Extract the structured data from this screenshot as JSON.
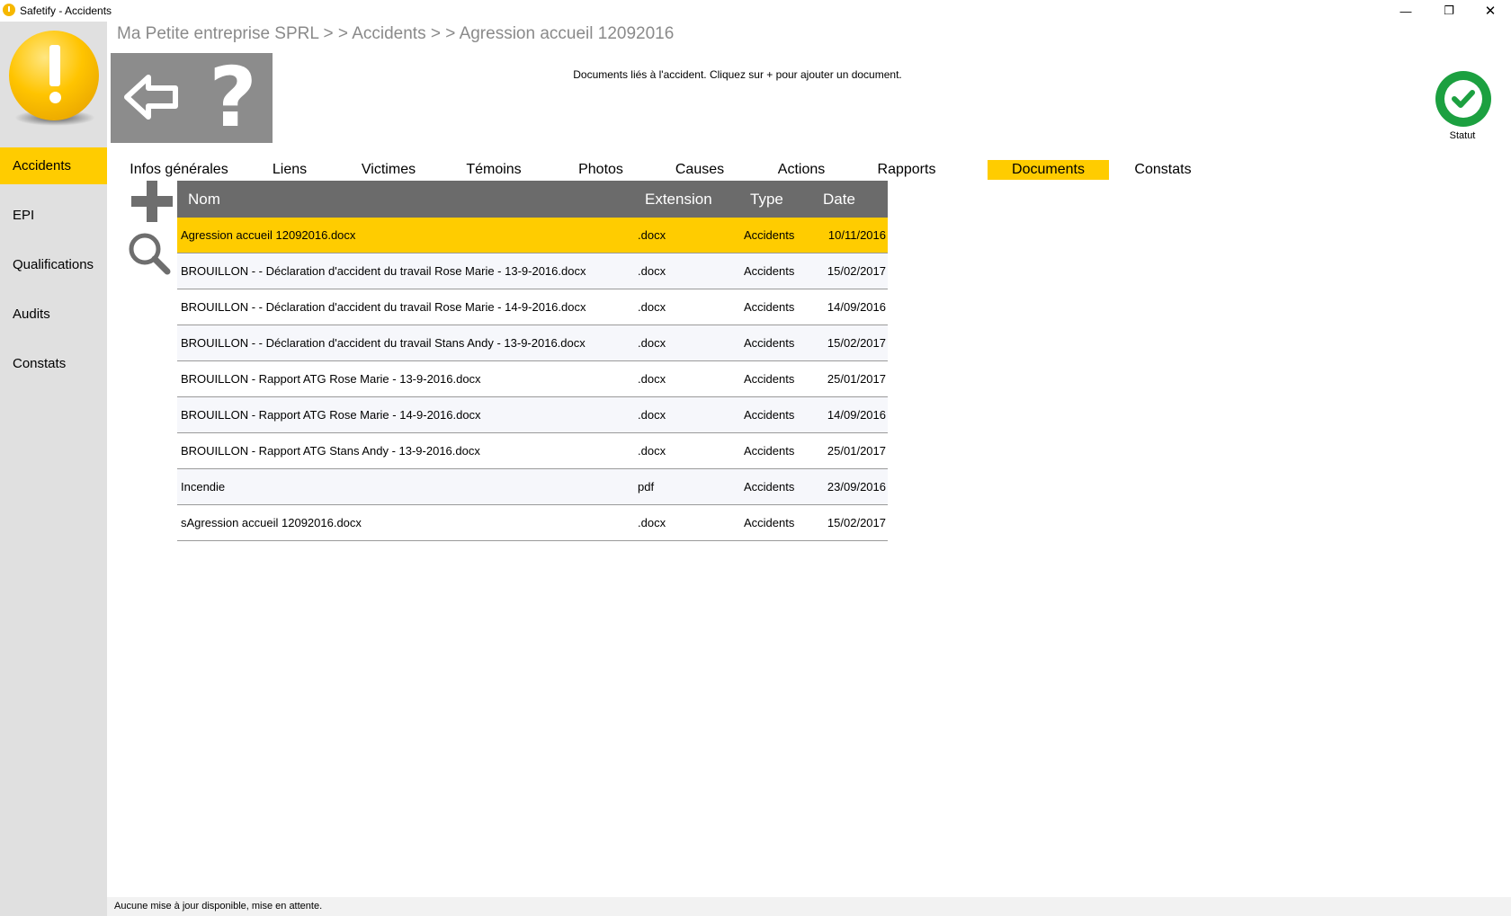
{
  "window": {
    "title": "Safetify - Accidents",
    "minimize": "—",
    "maximize": "❐",
    "close": "✕"
  },
  "breadcrumb": "Ma Petite entreprise SPRL > > Accidents > > Agression accueil 12092016",
  "instruction": "Documents liés à l'accident. Cliquez sur + pour ajouter un document.",
  "status": {
    "label": "Statut",
    "color": "#1ca040"
  },
  "toolbox": {
    "help_glyph": "?"
  },
  "sidebar": {
    "items": [
      {
        "label": "Accidents",
        "active": true
      },
      {
        "label": "EPI",
        "active": false
      },
      {
        "label": "Qualifications",
        "active": false
      },
      {
        "label": "Audits",
        "active": false
      },
      {
        "label": "Constats",
        "active": false
      }
    ]
  },
  "tabs": [
    {
      "label": "Infos générales",
      "active": false
    },
    {
      "label": "Liens",
      "active": false
    },
    {
      "label": "Victimes",
      "active": false
    },
    {
      "label": "Témoins",
      "active": false
    },
    {
      "label": "Photos",
      "active": false
    },
    {
      "label": "Causes",
      "active": false
    },
    {
      "label": "Actions",
      "active": false
    },
    {
      "label": "Rapports",
      "active": false
    },
    {
      "label": "Documents",
      "active": true
    },
    {
      "label": "Constats",
      "active": false
    }
  ],
  "table": {
    "headers": {
      "name": "Nom",
      "extension": "Extension",
      "type": "Type",
      "date": "Date"
    },
    "rows": [
      {
        "name": "Agression accueil 12092016.docx",
        "extension": ".docx",
        "type": "Accidents",
        "date": "10/11/2016",
        "selected": true
      },
      {
        "name": "BROUILLON -  - Déclaration d'accident du travail Rose Marie - 13-9-2016.docx",
        "extension": ".docx",
        "type": "Accidents",
        "date": "15/02/2017",
        "selected": false
      },
      {
        "name": "BROUILLON -  - Déclaration d'accident du travail Rose Marie - 14-9-2016.docx",
        "extension": ".docx",
        "type": "Accidents",
        "date": "14/09/2016",
        "selected": false
      },
      {
        "name": "BROUILLON -  - Déclaration d'accident du travail Stans Andy - 13-9-2016.docx",
        "extension": ".docx",
        "type": "Accidents",
        "date": "15/02/2017",
        "selected": false
      },
      {
        "name": "BROUILLON - Rapport ATG Rose Marie - 13-9-2016.docx",
        "extension": ".docx",
        "type": "Accidents",
        "date": "25/01/2017",
        "selected": false
      },
      {
        "name": "BROUILLON - Rapport ATG Rose Marie - 14-9-2016.docx",
        "extension": ".docx",
        "type": "Accidents",
        "date": "14/09/2016",
        "selected": false
      },
      {
        "name": "BROUILLON - Rapport ATG Stans Andy - 13-9-2016.docx",
        "extension": ".docx",
        "type": "Accidents",
        "date": "25/01/2017",
        "selected": false
      },
      {
        "name": "Incendie",
        "extension": "pdf",
        "type": "Accidents",
        "date": "23/09/2016",
        "selected": false
      },
      {
        "name": "sAgression accueil 12092016.docx",
        "extension": ".docx",
        "type": "Accidents",
        "date": "15/02/2017",
        "selected": false
      }
    ]
  },
  "statusbar": {
    "text": "Aucune mise à jour disponible, mise en attente."
  },
  "colors": {
    "accent": "#ffcc00",
    "sidebar_bg": "#e0e0e0",
    "header_bg": "#6b6b6b",
    "toolbox_bg": "#8c8c8c"
  },
  "icons": {
    "add": "plus-icon",
    "search": "search-icon",
    "back": "back-arrow-icon",
    "help": "help-icon",
    "status": "check-icon",
    "logo": "exclamation-logo-icon"
  }
}
